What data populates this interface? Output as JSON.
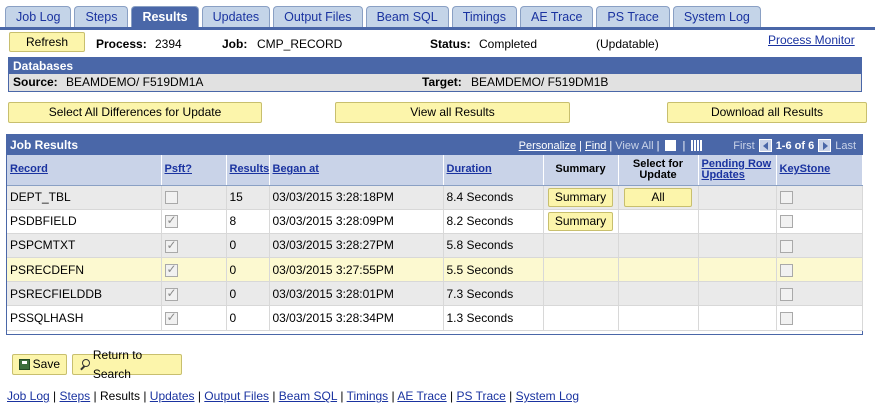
{
  "tabs": [
    {
      "label": "Job Log",
      "active": false
    },
    {
      "label": "Steps",
      "active": false
    },
    {
      "label": "Results",
      "active": true
    },
    {
      "label": "Updates",
      "active": false
    },
    {
      "label": "Output Files",
      "active": false
    },
    {
      "label": "Beam SQL",
      "active": false
    },
    {
      "label": "Timings",
      "active": false
    },
    {
      "label": "AE Trace",
      "active": false
    },
    {
      "label": "PS Trace",
      "active": false
    },
    {
      "label": "System Log",
      "active": false
    }
  ],
  "header": {
    "refresh_label": "Refresh",
    "process_label": "Process:",
    "process_value": "2394",
    "job_label": "Job:",
    "job_value": "CMP_RECORD",
    "status_label": "Status:",
    "status_value": "Completed",
    "updatable": "(Updatable)",
    "process_monitor_link": "Process Monitor"
  },
  "databases": {
    "title": "Databases",
    "source_label": "Source:",
    "source_value": "BEAMDEMO/ F519DM1A",
    "target_label": "Target:",
    "target_value": "BEAMDEMO/ F519DM1B"
  },
  "actions": {
    "select_all": "Select All Differences for Update",
    "view_all": "View all Results",
    "download_all": "Download all Results"
  },
  "grid": {
    "title": "Job Results",
    "nav": {
      "personalize": "Personalize",
      "find": "Find",
      "view_all": "View All",
      "first": "First",
      "range": "1-6 of 6",
      "last": "Last"
    },
    "columns": {
      "record": "Record",
      "psft": "Psft?",
      "results": "Results",
      "began_at": "Began at",
      "duration": "Duration",
      "summary": "Summary",
      "select_update": "Select for Update",
      "pending": "Pending Row Updates",
      "keystone": "KeyStone"
    },
    "rows": [
      {
        "record": "DEPT_TBL",
        "psft": false,
        "results": "15",
        "began_at": "03/03/2015  3:28:18PM",
        "duration": "8.4 Seconds",
        "summary_btn": "Summary",
        "select_btn": "All"
      },
      {
        "record": "PSDBFIELD",
        "psft": true,
        "results": "8",
        "began_at": "03/03/2015  3:28:09PM",
        "duration": "8.2 Seconds",
        "summary_btn": "Summary",
        "select_btn": ""
      },
      {
        "record": "PSPCMTXT",
        "psft": true,
        "results": "0",
        "began_at": "03/03/2015  3:28:27PM",
        "duration": "5.8 Seconds",
        "summary_btn": "",
        "select_btn": ""
      },
      {
        "record": "PSRECDEFN",
        "psft": true,
        "results": "0",
        "began_at": "03/03/2015  3:27:55PM",
        "duration": "5.5 Seconds",
        "summary_btn": "",
        "select_btn": ""
      },
      {
        "record": "PSRECFIELDDB",
        "psft": true,
        "results": "0",
        "began_at": "03/03/2015  3:28:01PM",
        "duration": "7.3 Seconds",
        "summary_btn": "",
        "select_btn": ""
      },
      {
        "record": "PSSQLHASH",
        "psft": true,
        "results": "0",
        "began_at": "03/03/2015  3:28:34PM",
        "duration": "1.3 Seconds",
        "summary_btn": "",
        "select_btn": ""
      }
    ]
  },
  "footer": {
    "save": "Save",
    "return_search": "Return to Search",
    "links": [
      "Job Log",
      "Steps",
      "Results",
      "Updates",
      "Output Files",
      "Beam SQL",
      "Timings",
      "AE Trace",
      "PS Trace",
      "System Log"
    ]
  },
  "colors": {
    "header_blue": "#4a67a8",
    "column_header": "#c9d3e8",
    "button_yellow": "#fcf5ab",
    "highlight_row": "#fcf9d0",
    "link": "#1a33a0"
  }
}
